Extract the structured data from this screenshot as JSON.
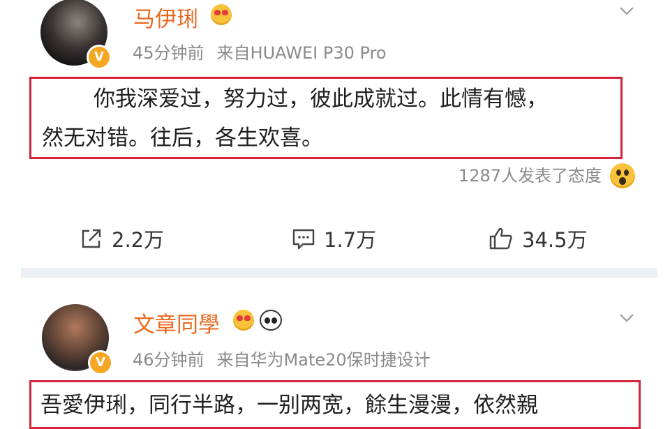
{
  "posts": [
    {
      "username": "马伊琍",
      "time": "45分钟前",
      "source": "来自HUAWEI P30 Pro",
      "content_lines": [
        "你我深爱过，努力过，彼此成就过。此情有憾，",
        "然无对错。往后，各生欢喜。"
      ],
      "reaction_text": "1287人发表了态度",
      "actions": {
        "share": "2.2万",
        "comment": "1.7万",
        "like": "34.5万"
      }
    },
    {
      "username": "文章同學",
      "time": "46分钟前",
      "source": "来自华为Mate20保时捷设计",
      "content_lines": [
        "吾愛伊琍，同行半路，一别两宽，餘生漫漫，依然親"
      ]
    }
  ],
  "colors": {
    "username": "#e86a20",
    "highlight_border": "#d6233c",
    "meta_text": "#8a8a8a",
    "separator": "#eceff3",
    "verified_badge": "#f5a623"
  },
  "icons": {
    "verified": "verified-badge-icon",
    "emoji_love": "heart-eyes-emoji-icon",
    "emoji_panda": "panda-emoji-icon",
    "emoji_wow": "surprised-emoji-icon",
    "menu": "chevron-down-icon",
    "share": "share-icon",
    "comment": "comment-icon",
    "like": "thumbs-up-icon"
  }
}
